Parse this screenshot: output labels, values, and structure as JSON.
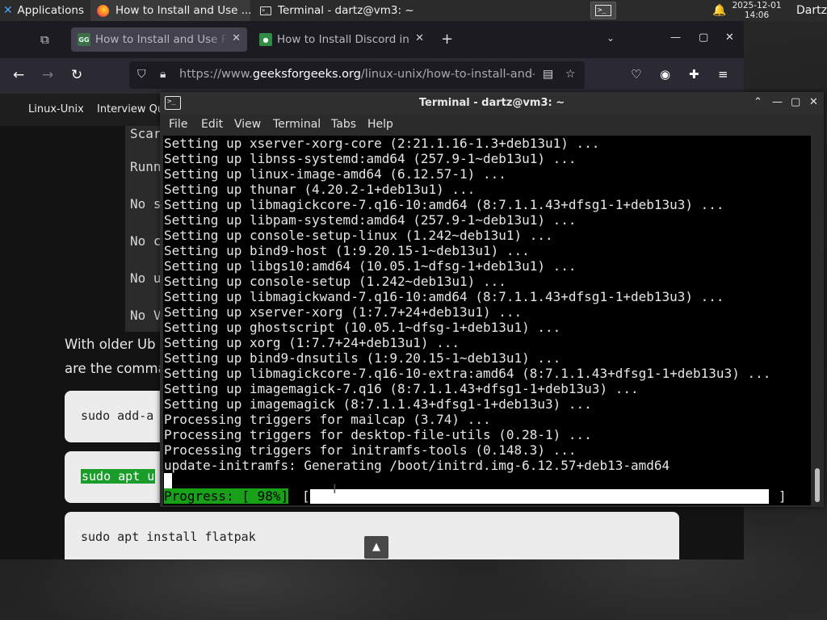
{
  "panel": {
    "applications_label": "Applications",
    "tasks": [
      {
        "label": "How to Install and Use ..."
      },
      {
        "label": "Terminal - dartz@vm3: ~"
      }
    ],
    "clock_date": "2025-12-01",
    "clock_time": "14:06",
    "user": "Dartz"
  },
  "browser": {
    "tabs": [
      {
        "title": "How to Install and Use Fl",
        "active": true
      },
      {
        "title": "How to Install Discord in",
        "active": false
      }
    ],
    "url_prefix": "https://www.",
    "url_host": "geeksforgeeks.org",
    "url_path": "/linux-unix/how-to-install-and-u",
    "site_nav": [
      "Linux-Unix",
      "Interview Qu"
    ],
    "page": {
      "code_lines": [
        "Scar",
        "Runn",
        "No s",
        "No c",
        "No u",
        "No V"
      ],
      "para_line1": "With older Ub",
      "para_line2": "are the comma",
      "cmd1": "sudo add-a",
      "cmd2": "sudo apt u",
      "cmd3": "sudo apt install flatpak",
      "scroll_top_glyph": "▲"
    }
  },
  "terminal": {
    "title": "Terminal - dartz@vm3: ~",
    "menu": [
      "File",
      "Edit",
      "View",
      "Terminal",
      "Tabs",
      "Help"
    ],
    "lines": [
      "Setting up xserver-xorg-core (2:21.1.16-1.3+deb13u1) ...",
      "Setting up libnss-systemd:amd64 (257.9-1~deb13u1) ...",
      "Setting up linux-image-amd64 (6.12.57-1) ...",
      "Setting up thunar (4.20.2-1+deb13u1) ...",
      "Setting up libmagickcore-7.q16-10:amd64 (8:7.1.1.43+dfsg1-1+deb13u3) ...",
      "Setting up libpam-systemd:amd64 (257.9-1~deb13u1) ...",
      "Setting up console-setup-linux (1.242~deb13u1) ...",
      "Setting up bind9-host (1:9.20.15-1~deb13u1) ...",
      "Setting up libgs10:amd64 (10.05.1~dfsg-1+deb13u1) ...",
      "Setting up console-setup (1.242~deb13u1) ...",
      "Setting up libmagickwand-7.q16-10:amd64 (8:7.1.1.43+dfsg1-1+deb13u3) ...",
      "Setting up xserver-xorg (1:7.7+24+deb13u1) ...",
      "Setting up ghostscript (10.05.1~dfsg-1+deb13u1) ...",
      "Setting up xorg (1:7.7+24+deb13u1) ...",
      "Setting up bind9-dnsutils (1:9.20.15-1~deb13u1) ...",
      "Setting up libmagickcore-7.q16-10-extra:amd64 (8:7.1.1.43+dfsg1-1+deb13u3) ...",
      "Setting up imagemagick-7.q16 (8:7.1.1.43+dfsg1-1+deb13u3) ...",
      "Setting up imagemagick (8:7.1.1.43+dfsg1-1+deb13u3) ...",
      "Processing triggers for mailcap (3.74) ...",
      "Processing triggers for desktop-file-utils (0.28-1) ...",
      "Processing triggers for initramfs-tools (0.148.3) ...",
      "update-initramfs: Generating /boot/initrd.img-6.12.57+deb13-amd64"
    ],
    "progress_label": "Progress: [ 98%]",
    "progress_percent": 98,
    "bracket_open": "[",
    "bracket_close": "]"
  },
  "colors": {
    "progress_green": "#18a019",
    "cmd_highlight": "#1a9c2a",
    "terminal_bg": "#000000"
  }
}
